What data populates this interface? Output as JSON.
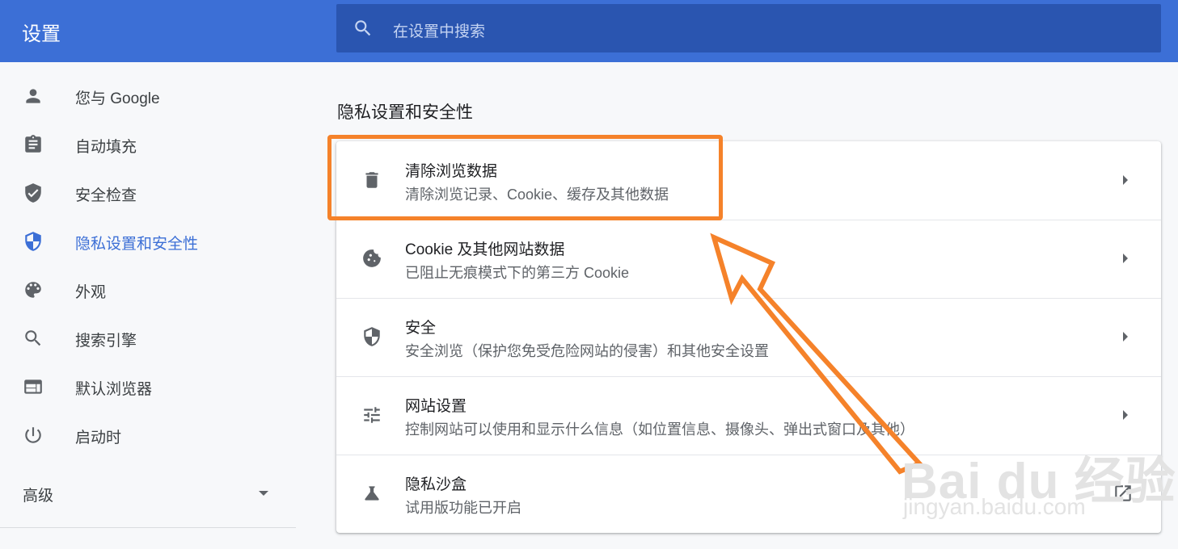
{
  "header": {
    "title": "设置",
    "search_placeholder": "在设置中搜索"
  },
  "sidebar": {
    "items": [
      {
        "label": "您与 Google",
        "icon": "person-icon"
      },
      {
        "label": "自动填充",
        "icon": "clipboard-icon"
      },
      {
        "label": "安全检查",
        "icon": "shield-check-icon"
      },
      {
        "label": "隐私设置和安全性",
        "icon": "privacy-shield-icon",
        "active": true
      },
      {
        "label": "外观",
        "icon": "palette-icon"
      },
      {
        "label": "搜索引擎",
        "icon": "search-icon"
      },
      {
        "label": "默认浏览器",
        "icon": "browser-window-icon"
      },
      {
        "label": "启动时",
        "icon": "power-icon"
      }
    ],
    "advanced_label": "高级"
  },
  "main": {
    "section_title": "隐私设置和安全性",
    "rows": [
      {
        "title": "清除浏览数据",
        "subtitle": "清除浏览记录、Cookie、缓存及其他数据",
        "icon": "trash-icon"
      },
      {
        "title": "Cookie 及其他网站数据",
        "subtitle": "已阻止无痕模式下的第三方 Cookie",
        "icon": "cookie-icon"
      },
      {
        "title": "安全",
        "subtitle": "安全浏览（保护您免受危险网站的侵害）和其他安全设置",
        "icon": "shield-icon"
      },
      {
        "title": "网站设置",
        "subtitle": "控制网站可以使用和显示什么信息（如位置信息、摄像头、弹出式窗口及其他）",
        "icon": "tune-icon"
      },
      {
        "title": "隐私沙盒",
        "subtitle": "试用版功能已开启",
        "icon": "flask-icon"
      }
    ]
  },
  "annotation": {
    "color": "#f5822a"
  },
  "watermark": {
    "logo_text": "Bai du 经验",
    "url_text": "jingyan.baidu.com"
  },
  "colors": {
    "header_bg": "#3c6fd6",
    "search_bg": "#2a55b0",
    "active_nav": "#3c6fd6"
  }
}
